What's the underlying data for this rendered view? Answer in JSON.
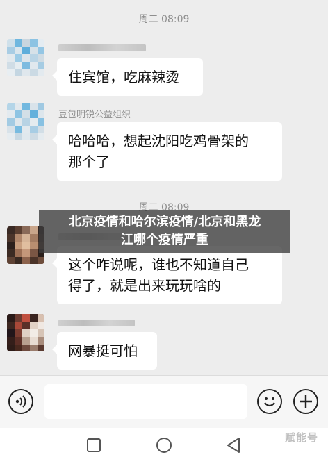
{
  "chat": {
    "timestamp_1": "周二 08:09",
    "timestamp_2": "周二 08:09",
    "messages": [
      {
        "sender": "",
        "text_lines": [
          "住宾馆，吃麻辣烫"
        ]
      },
      {
        "sender": "豆包明锐公益组织",
        "text_lines": [
          "哈哈哈，想起沈阳吃鸡骨架的",
          "那个了"
        ]
      },
      {
        "sender": "",
        "text_lines": [
          "这个咋说呢，谁也不知道自己",
          "得了，就是出来玩玩啥的"
        ]
      },
      {
        "sender": "",
        "text_lines": [
          "网暴挺可怕"
        ]
      }
    ]
  },
  "overlay": {
    "line1": "北京疫情和哈尔滨疫情/北京和黑龙",
    "line2": "江哪个疫情严重"
  },
  "input_bar": {
    "voice_icon": "voice-icon",
    "emoji_icon": "emoji-icon",
    "add_icon": "add-icon",
    "placeholder": ""
  },
  "nav_bar": {
    "icons": [
      "square-recent-icon",
      "circle-home-icon",
      "triangle-back-icon"
    ]
  },
  "watermark": "赋能号",
  "colors": {
    "background": "#ededed",
    "bubble": "#ffffff",
    "overlay": "#3c3c3c",
    "timestamp_text": "#8e8e8e"
  }
}
